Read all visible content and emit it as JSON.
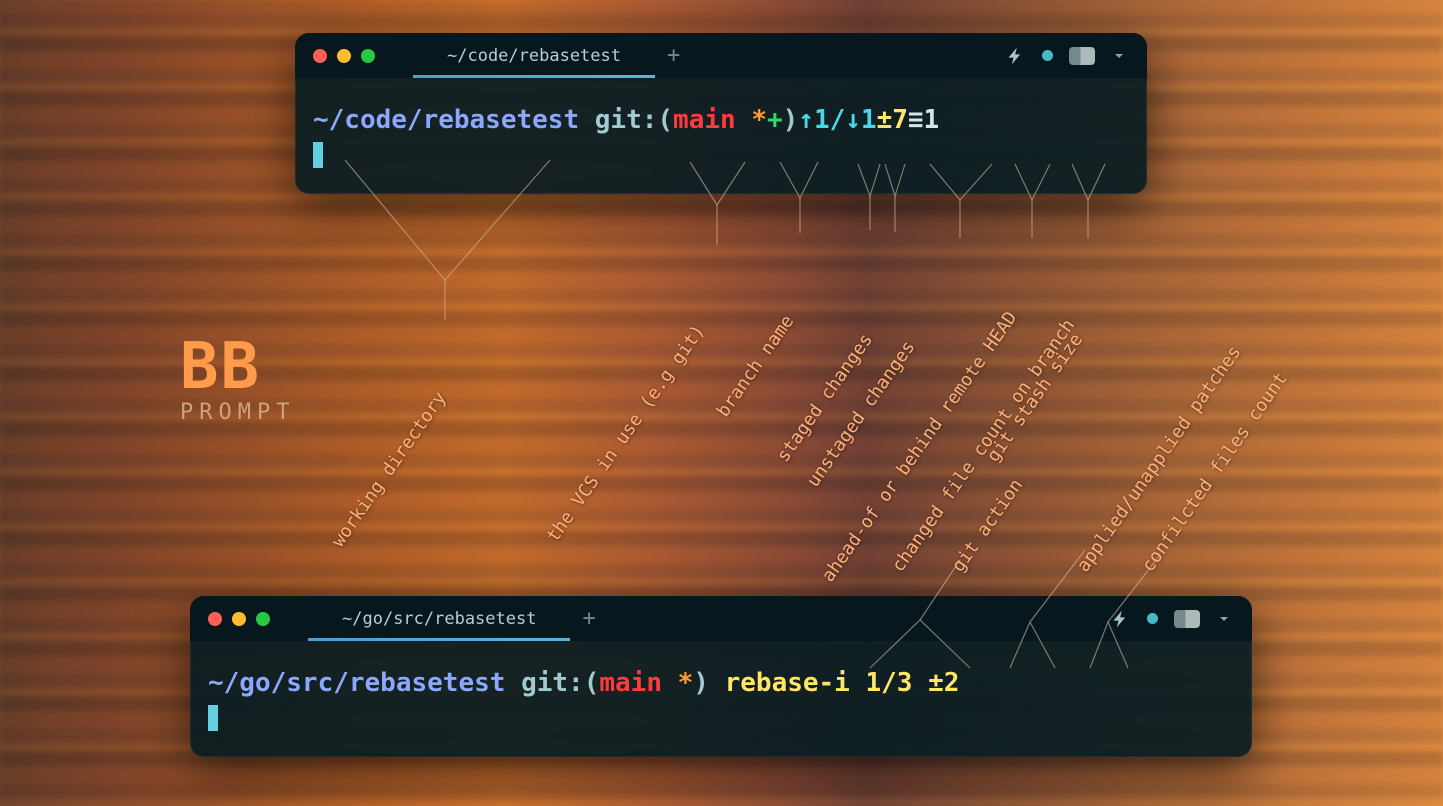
{
  "logo": {
    "title": "BB",
    "subtitle": "PROMPT"
  },
  "terminals": {
    "top": {
      "tab_title": "~/code/rebasetest",
      "prompt": {
        "path": "~/code/rebasetest",
        "vcs": "git:",
        "paren_open": "(",
        "branch": "main",
        "staged_marker": "*",
        "unstaged_marker": "+",
        "paren_close": ")",
        "ahead_behind": "↑1/↓1",
        "changed_files": "±7",
        "stash": "≡1"
      }
    },
    "bottom": {
      "tab_title": "~/go/src/rebasetest",
      "prompt": {
        "path": "~/go/src/rebasetest",
        "vcs": "git:",
        "paren_open": "(",
        "branch": "main",
        "staged_marker": "*",
        "paren_close": ")",
        "action": "rebase-i",
        "patches": "1/3",
        "conflicts": "±2"
      }
    }
  },
  "labels": {
    "working_directory": "working directory",
    "vcs": "the VCS in use (e.g git)",
    "branch": "branch name",
    "staged": "staged changes",
    "unstaged": "unstaged changes",
    "ahead_behind": "ahead-of or behind remote HEAD",
    "changed_files": "changed file count on branch",
    "stash": "git stash size",
    "action": "git action",
    "patches": "applied/unapplied patches",
    "conflicts": "confilcted files count"
  },
  "icons": {
    "plus": "+",
    "bolt": "bolt-icon",
    "chevron": "chevron-down-icon"
  }
}
